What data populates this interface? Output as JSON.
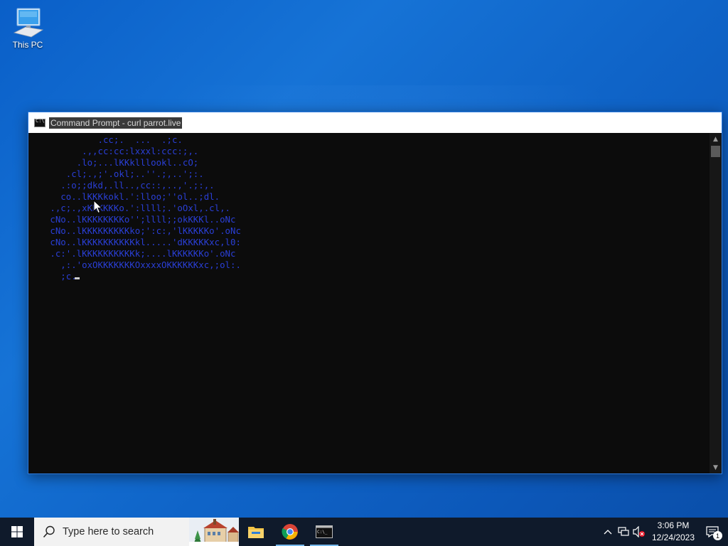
{
  "desktop": {
    "icons": [
      {
        "label": "This PC",
        "icon": "this-pc-icon"
      }
    ]
  },
  "window": {
    "title": "Command Prompt - curl  parrot.live",
    "icon": "cmd-icon",
    "console_lines": [
      "            .cc;.  ...  .;c.",
      "         .,,cc:cc:lxxxl:ccc:;,.",
      "        .lo;...lKKklllookl..cO;",
      "      .cl;.,;'.okl;..''.;,..';:.",
      "     .:o;;dkd,.ll..,cc::,..,'.;:,.",
      "     co..lKKKkokl.':lloo;''ol..;dl.",
      "   .,c;.,xKKKKKKo.':llll;.'oOxl,.cl,.",
      "   cNo..lKKKKKKKKo'';llll;;okKKKl..oNc",
      "   cNo..lKKKKKKKKKko;':c:,'lKKKKKo'.oNc",
      "   cNo..lKKKKKKKKKKkl.....'dKKKKKxc,l0:",
      "   .c:'.lKKKKKKKKKKk;....lKKKKKKo'.oNc",
      "     ,:.'oxOKKKKKKKOxxxxOKKKKKKxc,;ol:.",
      "     ;c."
    ],
    "text_color": "#2a3fd6",
    "background": "#0c0c0c"
  },
  "taskbar": {
    "start_icon": "windows-logo-icon",
    "search_placeholder": "Type here to search",
    "apps": [
      {
        "name": "File Explorer",
        "icon": "file-explorer-icon",
        "active": false
      },
      {
        "name": "Google Chrome",
        "icon": "chrome-icon",
        "active": true
      },
      {
        "name": "Command Prompt",
        "icon": "cmd-icon",
        "active": true
      }
    ],
    "tray": {
      "icons": [
        "chevron-up-icon",
        "network-icon",
        "volume-muted-icon"
      ],
      "time": "3:06 PM",
      "date": "12/24/2023",
      "notifications_count": "1"
    }
  },
  "colors": {
    "desktop_blue": "#1673d6",
    "taskbar": "#0f1a2b",
    "accent": "#76b9ed"
  }
}
